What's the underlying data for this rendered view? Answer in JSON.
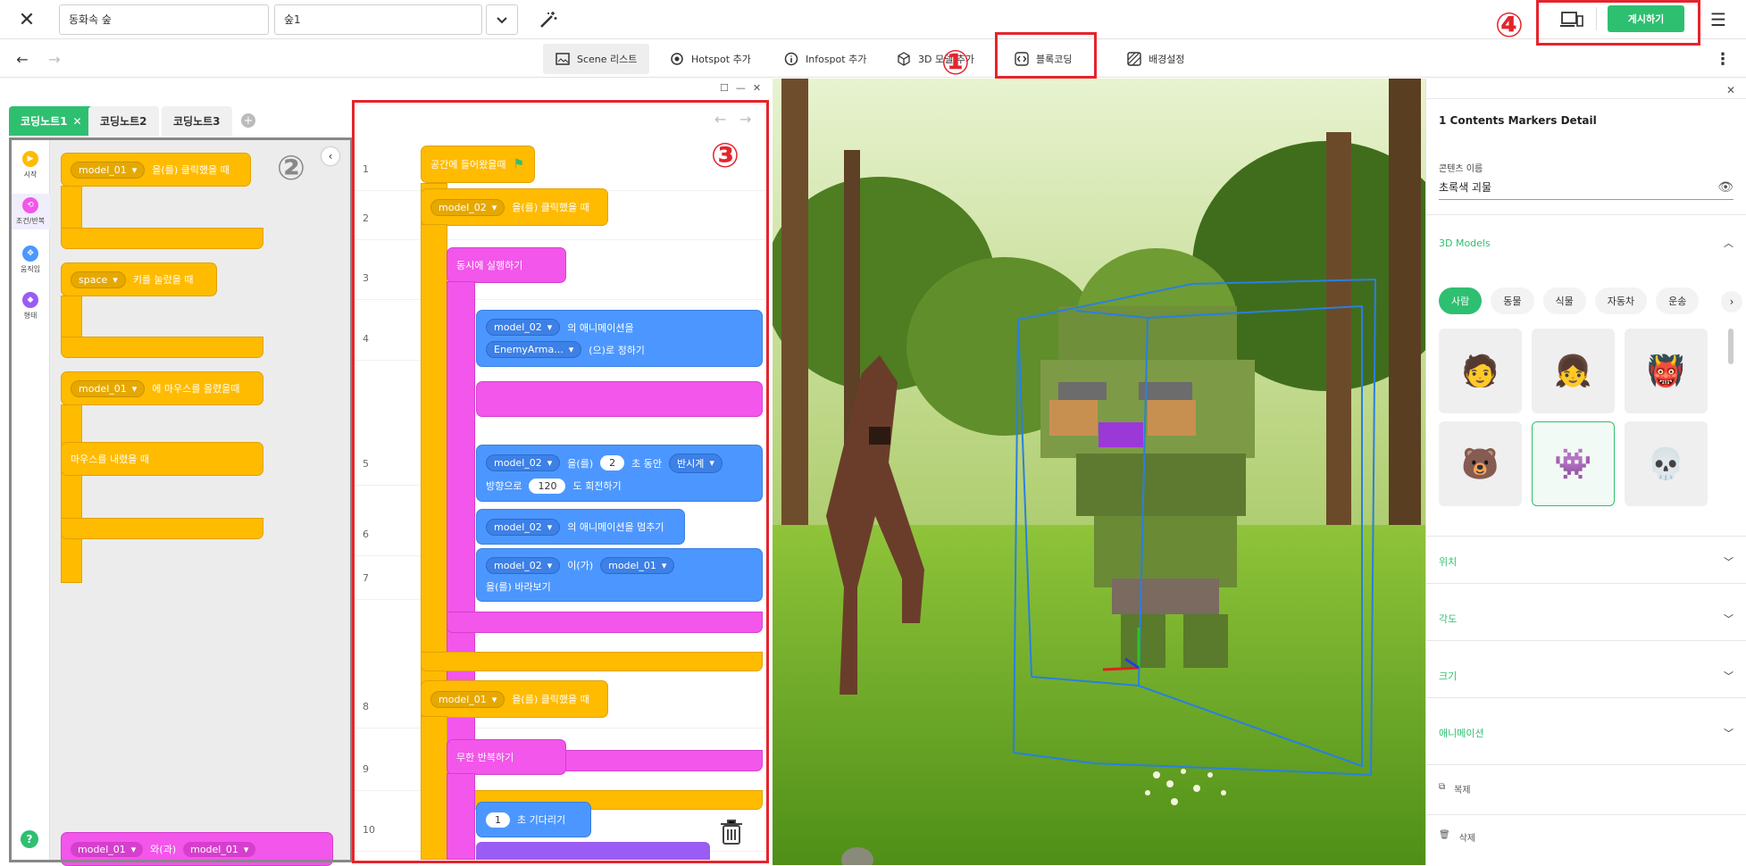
{
  "topbar": {
    "project_name": "동화속 숲",
    "scene_select": "숲1",
    "publish_label": "게시하기"
  },
  "toolbar": {
    "items": [
      {
        "label": "Scene 리스트",
        "icon": "scene-list-icon"
      },
      {
        "label": "Hotspot 추가",
        "icon": "hotspot-icon"
      },
      {
        "label": "Infospot 추가",
        "icon": "info-icon"
      },
      {
        "label": "3D 모델 추가",
        "icon": "cube-icon"
      },
      {
        "label": "블록코딩",
        "icon": "code-icon"
      },
      {
        "label": "배경설정",
        "icon": "background-icon"
      }
    ]
  },
  "annotations": {
    "one": "①",
    "two": "②",
    "three": "③",
    "four": "④"
  },
  "annotation_color": "#e5242c",
  "accent_color": "#2fbf71",
  "tabs": [
    {
      "label": "코딩노트1"
    },
    {
      "label": "코딩노트2"
    },
    {
      "label": "코딩노트3"
    }
  ],
  "categories": [
    {
      "label": "시작",
      "color": "#ffbb00"
    },
    {
      "label": "조건/반복",
      "color": "#f256ea"
    },
    {
      "label": "움직임",
      "color": "#4c97ff"
    },
    {
      "label": "형태",
      "color": "#9a5cf2"
    }
  ],
  "palette": {
    "b1_obj": "model_01",
    "b1_text": "을(를) 클릭했을 때",
    "b2_key": "space",
    "b2_text": "키를 눌렀을 때",
    "b3_obj": "model_01",
    "b3_text": "에 마우스를 올렸을때",
    "b3_sub": "마우스를 내렸을 때",
    "b4_obj1": "model_01",
    "b4_mid": "와(과)",
    "b4_obj2": "model_01"
  },
  "workspace": {
    "line_numbers": [
      "1",
      "2",
      "3",
      "4",
      "5",
      "6",
      "7",
      "8",
      "9",
      "10"
    ],
    "l1": "공간에 들어왔을때",
    "l2_obj": "model_02",
    "l2_text": "을(를) 클릭했을 때",
    "l3": "동시에 실행하기",
    "l4_obj": "model_02",
    "l4_text": "의 애니메이션을",
    "l4_anim": "EnemyArma...",
    "l4_text2": "(으)로 정하기",
    "l5_obj": "model_02",
    "l5_t1": "을(를)",
    "l5_sec": "2",
    "l5_t2": "초 동안",
    "l5_dir": "반시계",
    "l5_t3": "방향으로",
    "l5_deg": "120",
    "l5_t4": "도 회전하기",
    "l6_obj": "model_02",
    "l6_text": "의 애니메이션을 멈추기",
    "l7_obj": "model_02",
    "l7_t1": "이(가)",
    "l7_obj2": "model_01",
    "l7_t2": "을(를) 바라보기",
    "l8_obj": "model_01",
    "l8_text": "을(를) 클릭했을 때",
    "l9": "무한 반복하기",
    "l10_sec": "1",
    "l10_text": "초 기다리기"
  },
  "right_panel": {
    "title": "1 Contents Markers Detail",
    "content_name_label": "콘텐츠 이름",
    "content_name_value": "초록색 괴물",
    "models_section": "3D Models",
    "chips": [
      "사람",
      "동물",
      "식물",
      "자동차",
      "운송"
    ],
    "sections": [
      "위치",
      "각도",
      "크기",
      "애니메이션"
    ],
    "duplicate": "복제",
    "delete": "삭제"
  }
}
